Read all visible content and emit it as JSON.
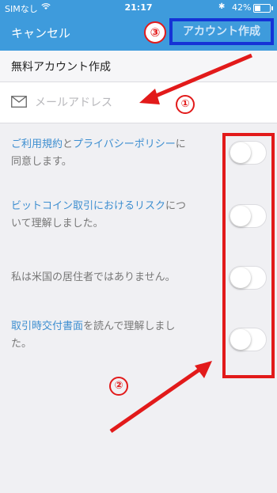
{
  "status_bar": {
    "carrier": "SIMなし",
    "time": "21:17",
    "battery_percent": "42%",
    "battery_level": 0.42
  },
  "nav": {
    "cancel_label": "キャンセル",
    "create_label": "アカウント作成"
  },
  "form": {
    "title": "無料アカウント作成",
    "email_placeholder": "メールアドレス",
    "email_value": ""
  },
  "agreements": [
    {
      "parts": [
        {
          "text": "ご利用規約",
          "link": true
        },
        {
          "text": "と",
          "link": false
        },
        {
          "text": "プライバシーポリシー",
          "link": true
        },
        {
          "text": "に同意します。",
          "link": false
        }
      ],
      "checked": false
    },
    {
      "parts": [
        {
          "text": "ビットコイン取引におけるリスク",
          "link": true
        },
        {
          "text": "について理解しました。",
          "link": false
        }
      ],
      "checked": false
    },
    {
      "parts": [
        {
          "text": "私は米国の居住者ではありません。",
          "link": false
        }
      ],
      "checked": false
    },
    {
      "parts": [
        {
          "text": "取引時交付書面",
          "link": true
        },
        {
          "text": "を読んで理解しました。",
          "link": false
        }
      ],
      "checked": false
    }
  ],
  "annotations": {
    "marker_1": "①",
    "marker_2": "②",
    "marker_3": "③",
    "accent_color": "#e21a1a",
    "highlight_color": "#1533d6"
  },
  "colors": {
    "nav_background": "#3e9bdc",
    "link": "#3d8ed0"
  }
}
